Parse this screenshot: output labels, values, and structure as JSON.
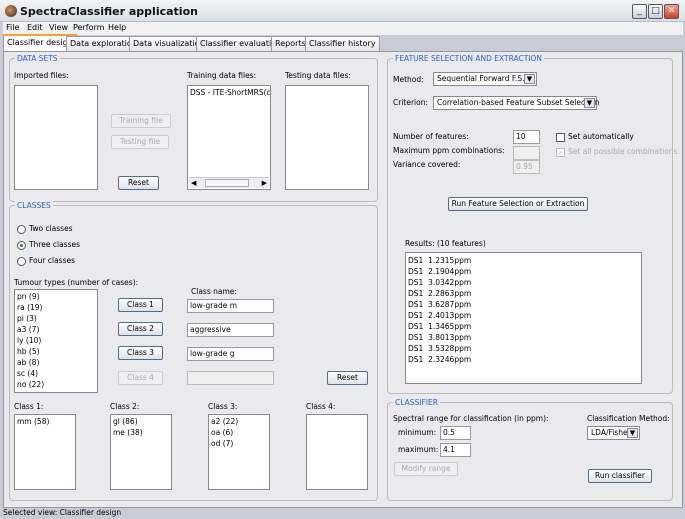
{
  "window": {
    "title": "SpectraClassifier application",
    "minimize": "_",
    "maximize": "□",
    "close": "✕"
  },
  "menu": [
    "File",
    "Edit",
    "View",
    "Perform",
    "Help"
  ],
  "tabs": [
    {
      "label": "Classifier design",
      "active": true
    },
    {
      "label": "Data exploration"
    },
    {
      "label": "Data visualization"
    },
    {
      "label": "Classifier evaluation"
    },
    {
      "label": "Reports"
    },
    {
      "label": "Classifier history"
    }
  ],
  "datasets": {
    "title": "DATA SETS",
    "imported_label": "Imported files:",
    "imported_files": [],
    "training_btn": "Training file",
    "testing_btn": "Testing file",
    "reset": "Reset",
    "training_label": "Training data files:",
    "training_files": [
      "DSS - ITE-ShortMRS(con"
    ],
    "testing_label": "Testing data files:",
    "testing_files": []
  },
  "classes": {
    "title": "CLASSES",
    "radios": [
      {
        "label": "Two classes",
        "selected": false
      },
      {
        "label": "Three classes",
        "selected": true
      },
      {
        "label": "Four classes",
        "selected": false
      }
    ],
    "tumour_label": "Tumour types (number of cases):",
    "tumour_types": [
      "pn (9)",
      "ra (19)",
      "pi (3)",
      "a3 (7)",
      "ly (10)",
      "hb (5)",
      "ab (8)",
      "sc (4)",
      "no (22)"
    ],
    "class_name_label": "Class name:",
    "class_buttons": [
      "Class 1",
      "Class 2",
      "Class 3",
      "Class 4"
    ],
    "class_names": [
      "low-grade m",
      "aggressive",
      "low-grade g",
      ""
    ],
    "reset": "Reset",
    "lists": [
      {
        "label": "Class 1:",
        "items": [
          "mm (58)"
        ]
      },
      {
        "label": "Class 2:",
        "items": [
          "gl (86)",
          "me (38)"
        ]
      },
      {
        "label": "Class 3:",
        "items": [
          "a2 (22)",
          "oa (6)",
          "od (7)"
        ]
      },
      {
        "label": "Class 4:",
        "items": []
      }
    ]
  },
  "feature": {
    "title": "FEATURE SELECTION AND EXTRACTION",
    "method_label": "Method:",
    "method": "Sequential Forward F.S.",
    "criterion_label": "Criterion:",
    "criterion": "Correlation-based Feature Subset Selection",
    "num_features_label": "Number of features:",
    "num_features": "10",
    "max_ppm_label": "Maximum ppm combinations:",
    "max_ppm": "",
    "variance_label": "Variance covered:",
    "variance": "0.95",
    "set_auto_label": "Set automatically",
    "set_auto": false,
    "set_all_label": "Set all possible combinations",
    "set_all": true,
    "run_btn": "Run Feature Selection or Extraction",
    "results_label": "Results: (10 features)",
    "results": [
      "DS1  1.2315ppm",
      "DS1  2.1904ppm",
      "DS1  3.0342ppm",
      "DS1  2.2863ppm",
      "DS1  3.6287ppm",
      "DS1  2.4013ppm",
      "DS1  1.3465ppm",
      "DS1  3.8013ppm",
      "DS1  3.5328ppm",
      "DS1  2.3246ppm"
    ]
  },
  "classifier": {
    "title": "CLASSIFIER",
    "range_label": "Spectral range for classification (in ppm):",
    "min_label": "minimum:",
    "min": "0.5",
    "max_label": "maximum:",
    "max": "4.1",
    "modify_btn": "Modify range",
    "method_label": "Classification Method:",
    "method": "LDA/Fisher",
    "run_btn": "Run classifier"
  },
  "status": "Selected view: Classifier design"
}
